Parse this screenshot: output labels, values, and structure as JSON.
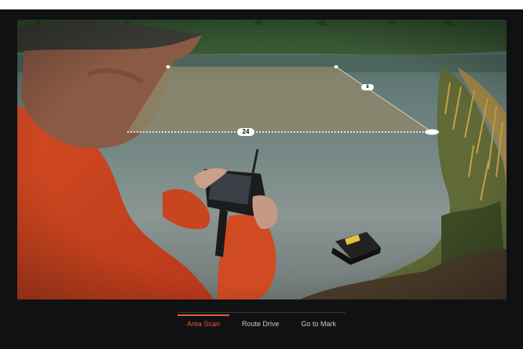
{
  "overlay": {
    "width_label": "24",
    "depth_label": "8"
  },
  "mode_tabs": {
    "active": "Area Scan",
    "items": [
      {
        "label": "Area Scan"
      },
      {
        "label": "Route Drive"
      },
      {
        "label": "Go to Mark"
      }
    ]
  },
  "colors": {
    "accent": "#e65a32",
    "background": "#101112",
    "overlay_fill": "#8d866a"
  }
}
